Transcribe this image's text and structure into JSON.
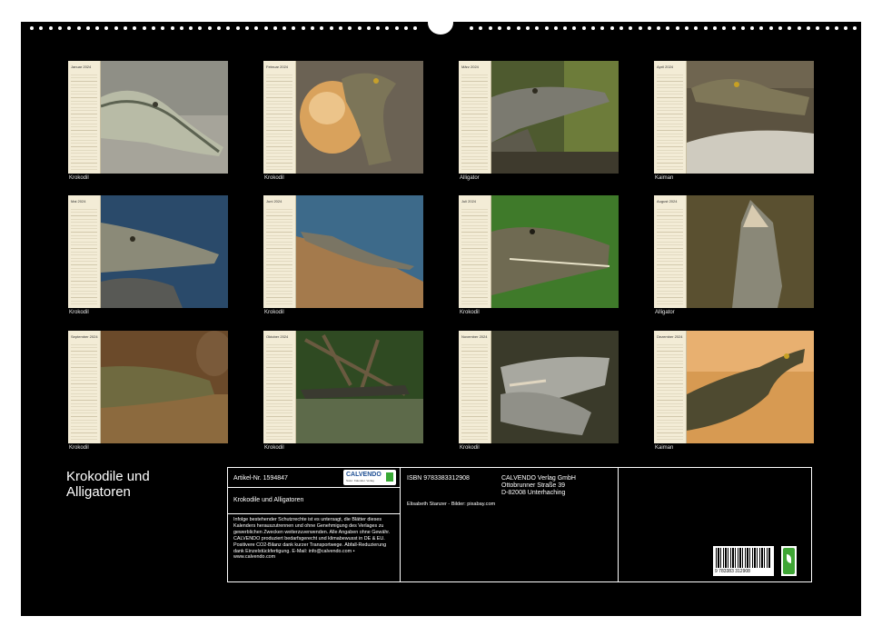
{
  "title": "Krokodile und Alligatoren",
  "months": [
    {
      "name": "Januar 2024",
      "caption": "Krokodil"
    },
    {
      "name": "Februar 2024",
      "caption": "Krokodil"
    },
    {
      "name": "März 2024",
      "caption": "Alligator"
    },
    {
      "name": "April 2024",
      "caption": "Kaiman"
    },
    {
      "name": "Mai 2024",
      "caption": "Krokodil"
    },
    {
      "name": "Juni 2024",
      "caption": "Krokodil"
    },
    {
      "name": "Juli 2024",
      "caption": "Krokodil"
    },
    {
      "name": "August 2024",
      "caption": "Alligator"
    },
    {
      "name": "September 2024",
      "caption": "Krokodil"
    },
    {
      "name": "Oktober 2024",
      "caption": "Krokodil"
    },
    {
      "name": "November 2024",
      "caption": "Krokodil"
    },
    {
      "name": "Dezember 2024",
      "caption": "Kaiman"
    }
  ],
  "info": {
    "article": "Artikel-Nr. 1594847",
    "calendar_title": "Krokodile und Alligatoren",
    "legal": "Infolge bestehender Schutzrechte ist es untersagt, die Blätter dieses Kalenders herauszutrennen und ohne Genehmigung des Verlages zu gewerblichen Zwecken weiterzuverwenden. Alle Angaben ohne Gewähr. CALVENDO produziert bedarfsgerecht und klimabewusst in DE & EU. Positivere CO2-Bilanz dank kurzer Transportwege. Abfall-Reduzierung dank Einzelstückfertigung. E-Mail: info@calvendo.com • www.calvendo.com",
    "isbn": "ISBN 9783383312908",
    "publisher": [
      "CALVENDO Verlag GmbH",
      "Ottobrunner Straße 39",
      "D-82008 Unterhaching"
    ],
    "credits": "Elisabeth Stanzer - Bilder: pixabay.com",
    "barcode_number": "9 783383 312908",
    "logo_text": "CALVENDO",
    "logo_sub": "Natur. Kalender. Verlag"
  },
  "colors": {
    "sheet": "#000000",
    "panel": "#f3ecd6",
    "eco": "#3fa535",
    "logo": "#1e4f94"
  }
}
